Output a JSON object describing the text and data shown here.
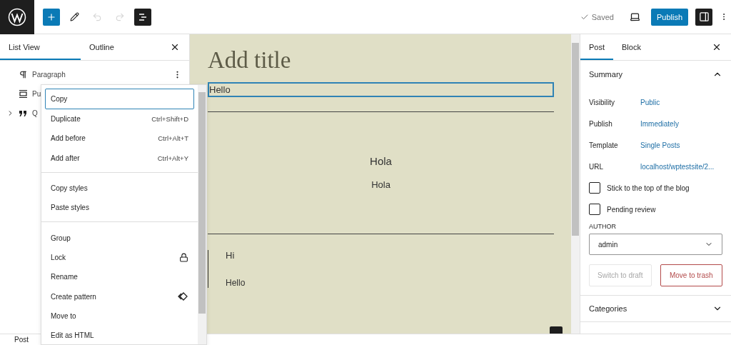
{
  "toolbar": {
    "tools": [
      {
        "kind": "inserter",
        "disabled": false,
        "pressed": false
      },
      {
        "kind": "tools",
        "disabled": false,
        "pressed": false
      },
      {
        "kind": "undo",
        "disabled": true,
        "pressed": false
      },
      {
        "kind": "redo",
        "disabled": true,
        "pressed": false
      },
      {
        "kind": "list_view",
        "disabled": false,
        "pressed": true
      }
    ],
    "saved": "Saved",
    "publish": "Publish",
    "settings_pressed": true
  },
  "list_panel": {
    "tabs": [
      {
        "label": "List View",
        "selected": true
      },
      {
        "label": "Outline",
        "selected": false
      }
    ],
    "items": [
      {
        "kind": "paragraph",
        "label": "Paragraph",
        "expandable": false
      },
      {
        "kind": "pullquote",
        "label": "Pu",
        "expandable": false
      },
      {
        "kind": "quote",
        "label": "Q",
        "expandable": true
      }
    ]
  },
  "context_menu": {
    "groups": [
      [
        {
          "label": "Copy",
          "selected": true
        },
        {
          "label": "Duplicate",
          "shortcut": "Ctrl+Shift+D",
          "selected": false
        },
        {
          "label": "Add before",
          "shortcut": "Ctrl+Alt+T",
          "selected": false
        },
        {
          "label": "Add after",
          "shortcut": "Ctrl+Alt+Y",
          "selected": false
        }
      ],
      [
        {
          "label": "Copy styles",
          "selected": false
        },
        {
          "label": "Paste styles",
          "selected": false
        }
      ],
      [
        {
          "kind": "plain",
          "label": "Group",
          "selected": false
        },
        {
          "kind": "lock",
          "label": "Lock",
          "selected": false
        },
        {
          "kind": "plain",
          "label": "Rename",
          "selected": false
        },
        {
          "kind": "pattern",
          "label": "Create pattern",
          "selected": false
        },
        {
          "kind": "plain",
          "label": "Move to",
          "selected": false
        },
        {
          "kind": "plain",
          "label": "Edit as HTML",
          "selected": false
        }
      ]
    ]
  },
  "canvas": {
    "title_placeholder": "Add title",
    "blocks": [
      {
        "kind": "paragraph",
        "text": "Hello",
        "selected": true
      },
      {
        "kind": "separator",
        "selected": false
      },
      {
        "kind": "heading",
        "text": "Hola",
        "selected": false
      },
      {
        "kind": "centered_paragraph",
        "text": "Hola",
        "selected": false
      },
      {
        "kind": "separator",
        "selected": false
      },
      {
        "kind": "quote",
        "lines": [
          "Hi",
          "Hello"
        ],
        "selected": false
      }
    ]
  },
  "sidebar": {
    "tabs": [
      {
        "label": "Post",
        "selected": true
      },
      {
        "label": "Block",
        "selected": false
      }
    ],
    "summary": {
      "title": "Summary",
      "expanded": true,
      "rows": [
        {
          "label": "Visibility",
          "value": "Public"
        },
        {
          "label": "Publish",
          "value": "Immediately"
        },
        {
          "label": "Template",
          "value": "Single Posts"
        },
        {
          "label": "URL",
          "value": "localhost/wptestsite/2..."
        }
      ],
      "checkboxes": [
        {
          "label": "Stick to the top of the blog",
          "checked": false
        },
        {
          "label": "Pending review",
          "checked": false
        }
      ],
      "author_label": "AUTHOR",
      "author": "admin",
      "buttons": [
        {
          "kind": "secondary",
          "label": "Switch to draft",
          "disabled": true
        },
        {
          "kind": "destructive",
          "label": "Move to trash",
          "disabled": false
        }
      ]
    },
    "sections": [
      {
        "title": "Categories",
        "expanded": false
      }
    ]
  },
  "footer": {
    "breadcrumb": "Post"
  }
}
